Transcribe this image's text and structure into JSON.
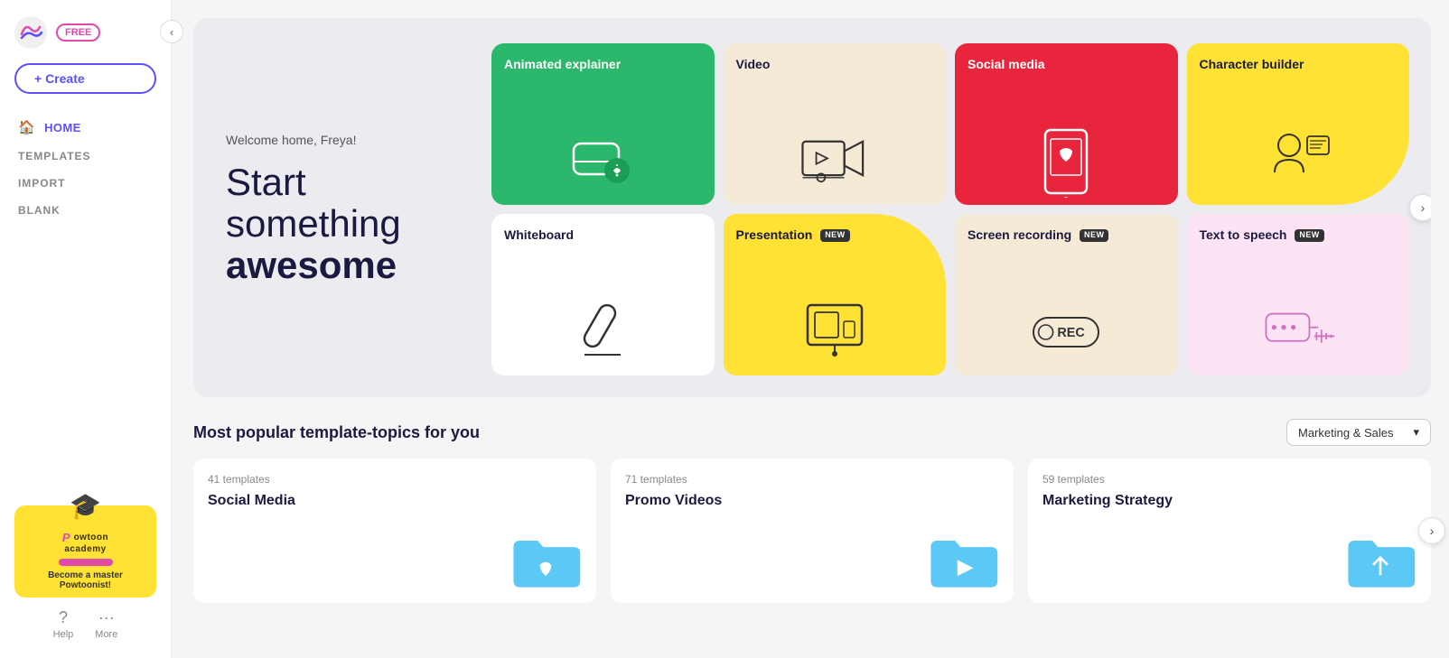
{
  "sidebar": {
    "free_badge": "FREE",
    "create_label": "+ Create",
    "nav_items": [
      {
        "id": "home",
        "label": "HOME",
        "active": true,
        "icon": "🏠"
      },
      {
        "id": "templates",
        "label": "TEMPLATES",
        "active": false
      },
      {
        "id": "import",
        "label": "IMPORT",
        "active": false
      },
      {
        "id": "blank",
        "label": "BLANK",
        "active": false
      }
    ],
    "academy": {
      "become_label": "Become a master",
      "become_sub": "Powtoonist!"
    },
    "footer_items": [
      {
        "id": "help",
        "label": "Help",
        "icon": "?"
      },
      {
        "id": "more",
        "label": "More",
        "icon": "..."
      }
    ]
  },
  "hero": {
    "welcome": "Welcome home, Freya!",
    "title_line1": "Start",
    "title_line2": "something",
    "title_line3": "awesome"
  },
  "cards": {
    "row1": [
      {
        "id": "animated-explainer",
        "title": "Animated explainer",
        "badge": null,
        "color": "green"
      },
      {
        "id": "video",
        "title": "Video",
        "badge": null,
        "color": "cream"
      },
      {
        "id": "social-media",
        "title": "Social media",
        "badge": null,
        "color": "red"
      },
      {
        "id": "character-builder",
        "title": "Character builder",
        "badge": null,
        "color": "yellow"
      }
    ],
    "row2": [
      {
        "id": "whiteboard",
        "title": "Whiteboard",
        "badge": null,
        "color": "white"
      },
      {
        "id": "presentation",
        "title": "Presentation",
        "badge": "NEW",
        "color": "yellow"
      },
      {
        "id": "screen-recording",
        "title": "Screen recording",
        "badge": "NEW",
        "color": "cream"
      },
      {
        "id": "text-to-speech",
        "title": "Text to speech",
        "badge": "NEW",
        "color": "pink"
      }
    ]
  },
  "popular": {
    "section_title": "Most popular template-topics for you",
    "dropdown_value": "Marketing & Sales",
    "dropdown_arrow": "▾",
    "templates": [
      {
        "id": "social-media-t",
        "count": "41 templates",
        "name": "Social Media",
        "folder_color": "#5bc8f5"
      },
      {
        "id": "promo-videos",
        "count": "71 templates",
        "name": "Promo Videos",
        "folder_color": "#5bc8f5"
      },
      {
        "id": "marketing-strategy",
        "count": "59 templates",
        "name": "Marketing Strategy",
        "folder_color": "#5bc8f5"
      }
    ]
  }
}
